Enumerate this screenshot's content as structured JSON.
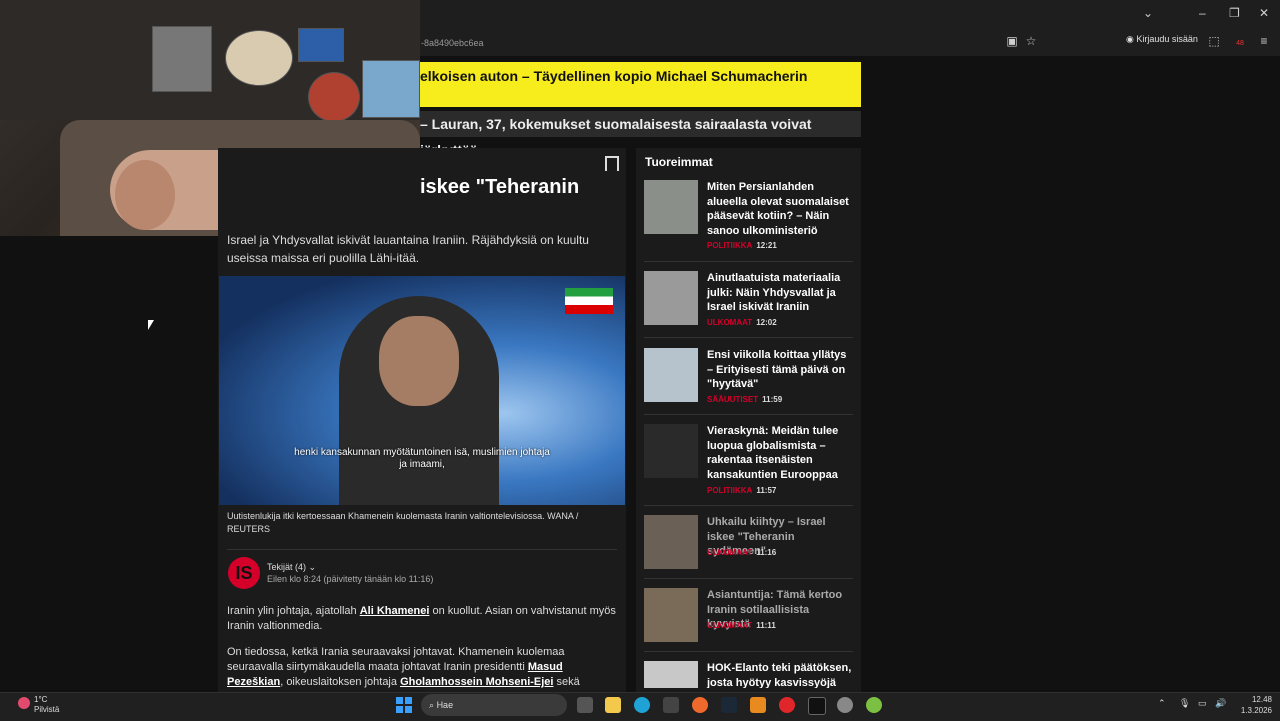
{
  "browser": {
    "url_text": "-8a8490ebc6ea",
    "sign_in_label": "Kirjaudu sisään",
    "extension_badge": "48"
  },
  "banners": {
    "yellow": "elkoisen auton – Täydellinen kopio Michael Schumacherin",
    "dark": "– Lauran, 37, kokemukset suomalaisesta sairaalasta voivat järkyttää"
  },
  "article": {
    "headline": "iskee \"Teheranin",
    "lead": "Israel ja Yhdysvallat iskivät lauantaina Iraniin. Räjähdyksiä on kuultu useissa maissa eri puolilla Lähi-itää.",
    "video_subtitle": "henki kansakunnan myötätuntoinen isä, muslimien johtaja ja imaami,",
    "caption": "Uutistenlukija itki kertoessaan Khamenein kuolemasta Iranin valtiontelevisiossa. WANA / REUTERS",
    "authors": "Tekijät (4)",
    "dates": "Eilen klo 8:24 (päivitetty tänään klo 11:16)",
    "logo_letter": "IS",
    "p1_before": "Iranin ylin johtaja, ajatollah ",
    "p1_link": "Ali Khamenei",
    "p1_after": " on kuollut. Asian on vahvistanut myös Iranin valtionmedia.",
    "p2_before": "On tiedossa, ketkä Irania seuraavaksi johtavat. Khamenein kuolemaa seuraavalla siirtymäkaudella maata johtavat Iranin presidentti ",
    "p2_link1": "Masud Pezeškian",
    "p2_mid": ", oikeuslaitoksen johtaja ",
    "p2_link2": "Gholamhossein Mohseni-Ejei",
    "p2_after": " sekä edustaja"
  },
  "sidebar": {
    "title": "Tuoreimmat",
    "items": [
      {
        "title": "Miten Persianlahden alueella olevat suomalaiset pääsevät kotiin? – Näin sanoo ulkoministeriö",
        "category": "POLITIIKKA",
        "time": "12:21"
      },
      {
        "title": "Ainutlaatuista materiaalia julki: Näin Yhdysvallat ja Israel iskivät Iraniin",
        "category": "ULKOMAAT",
        "time": "12:02"
      },
      {
        "title": "Ensi viikolla koittaa yllätys – Erityisesti tämä päivä on \"hyytävä\"",
        "category": "SÄÄUUTISET",
        "time": "11:59"
      },
      {
        "title": "Vieraskynä: Meidän tulee luopua globalismista – rakentaa itsenäisten kansakuntien Eurooppaa",
        "category": "POLITIIKKA",
        "time": "11:57"
      },
      {
        "title": "Uhkailu kiihtyy – Israel iskee \"Teheranin sydämeen\"",
        "category": "ULKOMAAT",
        "time": "11:16"
      },
      {
        "title": "Asiantuntija: Tämä kertoo Iranin sotilaallisista kyvyistä",
        "category": "ULKOMAAT",
        "time": "11:11"
      },
      {
        "title": "HOK-Elanto teki päätöksen, josta hyötyy kasvissyöjä",
        "category": "",
        "time": ""
      }
    ]
  },
  "taskbar": {
    "temperature": "1°C",
    "weather": "Pilvistä",
    "search_label": "Hae",
    "time": "12.48",
    "date": "1.3.2026"
  },
  "colors": {
    "accent_red": "#d4002a",
    "banner_yellow": "#f7ec1c"
  }
}
